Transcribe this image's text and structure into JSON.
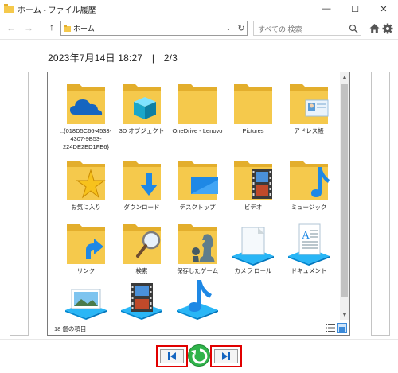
{
  "window": {
    "title": "ホーム - ファイル履歴"
  },
  "titlebar_buttons": {
    "minimize": "—",
    "maximize": "☐",
    "close": "✕"
  },
  "nav": {
    "back": "←",
    "forward": "→",
    "up": "↑",
    "dropdown": "⌄",
    "refresh": "↻"
  },
  "address": {
    "text": "ホーム"
  },
  "search": {
    "placeholder": "すべての 検索"
  },
  "snapshot": {
    "datetime": "2023年7月14日 18:27",
    "separator": "|",
    "page": "2/3"
  },
  "items": [
    {
      "label": "::{018D5C66-4533-4307-9B53-224DE2ED1FE6}",
      "icon": "onedrive-folder-icon"
    },
    {
      "label": "3D オブジェクト",
      "icon": "3d-objects-folder-icon"
    },
    {
      "label": "OneDrive - Lenovo",
      "icon": "onedrive-lenovo-folder-icon"
    },
    {
      "label": "Pictures",
      "icon": "pictures-folder-icon"
    },
    {
      "label": "アドレス帳",
      "icon": "contacts-folder-icon"
    },
    {
      "label": "お気に入り",
      "icon": "favorites-folder-icon"
    },
    {
      "label": "ダウンロード",
      "icon": "downloads-folder-icon"
    },
    {
      "label": "デスクトップ",
      "icon": "desktop-folder-icon"
    },
    {
      "label": "ビデオ",
      "icon": "videos-folder-icon"
    },
    {
      "label": "ミュージック",
      "icon": "music-folder-icon"
    },
    {
      "label": "リンク",
      "icon": "links-folder-icon"
    },
    {
      "label": "検索",
      "icon": "searches-folder-icon"
    },
    {
      "label": "保存したゲーム",
      "icon": "saved-games-folder-icon"
    },
    {
      "label": "カメラ ロール",
      "icon": "camera-roll-library-icon"
    },
    {
      "label": "ドキュメント",
      "icon": "documents-library-icon"
    },
    {
      "label": "",
      "icon": "pictures-library-icon"
    },
    {
      "label": "",
      "icon": "videos-library-icon"
    },
    {
      "label": "",
      "icon": "music-library-icon"
    }
  ],
  "status": {
    "count": "18 個の項目"
  },
  "controls": {
    "previous": "previous-version",
    "restore": "restore",
    "next": "next-version"
  },
  "colors": {
    "folder": "#f5c94c",
    "folder_dark": "#e3ae2c",
    "accent_red": "#e10000",
    "restore_green": "#2fb34a",
    "blue": "#1e88e5"
  }
}
